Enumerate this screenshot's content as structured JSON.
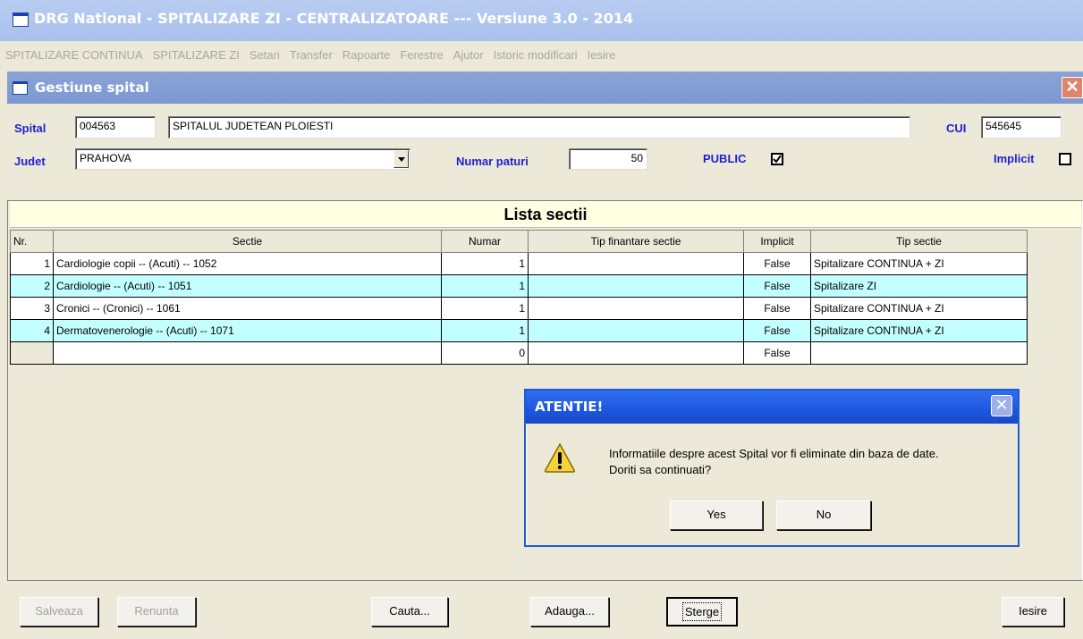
{
  "app": {
    "title": "DRG National - SPITALIZARE ZI - CENTRALIZATOARE  --- Versiune 3.0 - 2014"
  },
  "menu": [
    "SPITALIZARE CONTINUA",
    "SPITALIZARE ZI",
    "Setari",
    "Transfer",
    "Rapoarte",
    "Ferestre",
    "Ajutor",
    "Istoric modificari",
    "Iesire"
  ],
  "window": {
    "title": "Gestiune spital",
    "close_glyph": "✕"
  },
  "form": {
    "spital_label": "Spital",
    "spital_code": "004563",
    "spital_name": "SPITALUL JUDETEAN PLOIESTI",
    "cui_label": "CUI",
    "cui_value": "545645",
    "judet_label": "Judet",
    "judet_value": "PRAHOVA",
    "paturi_label": "Numar paturi",
    "paturi_value": "50",
    "public_label": "PUBLIC",
    "public_checked": true,
    "implicit_label": "Implicit",
    "implicit_checked": false
  },
  "grid": {
    "title": "Lista sectii",
    "columns": [
      "Nr.",
      "Sectie",
      "Numar",
      "Tip finantare sectie",
      "Implicit",
      "Tip sectie"
    ],
    "rows": [
      {
        "nr": "1",
        "sectie": "Cardiologie copii -- (Acuti) -- 1052",
        "numar": "1",
        "finantare": "",
        "implicit": "False",
        "tip": "Spitalizare CONTINUA + ZI"
      },
      {
        "nr": "2",
        "sectie": "Cardiologie -- (Acuti) -- 1051",
        "numar": "1",
        "finantare": "",
        "implicit": "False",
        "tip": "Spitalizare ZI"
      },
      {
        "nr": "3",
        "sectie": "Cronici -- (Cronici) -- 1061",
        "numar": "1",
        "finantare": "",
        "implicit": "False",
        "tip": "Spitalizare CONTINUA + ZI"
      },
      {
        "nr": "4",
        "sectie": "Dermatovenerologie -- (Acuti) -- 1071",
        "numar": "1",
        "finantare": "",
        "implicit": "False",
        "tip": "Spitalizare CONTINUA + ZI"
      },
      {
        "nr": "",
        "sectie": "",
        "numar": "0",
        "finantare": "",
        "implicit": "False",
        "tip": ""
      }
    ]
  },
  "dialog": {
    "title": "ATENTIE!",
    "line1": "Informatiile despre acest Spital vor fi eliminate din baza de date.",
    "line2": "Doriti sa continuati?",
    "yes": "Yes",
    "no": "No",
    "close_glyph": "✕"
  },
  "buttons": {
    "salveaza": "Salveaza",
    "renunta": "Renunta",
    "cauta": "Cauta...",
    "adauga": "Adauga...",
    "sterge": "Sterge",
    "iesire": "Iesire"
  },
  "colors": {
    "label_blue": "#1f1fcf",
    "row_alt": "#c3ffff",
    "grid_title_bg": "#ffffe1"
  }
}
